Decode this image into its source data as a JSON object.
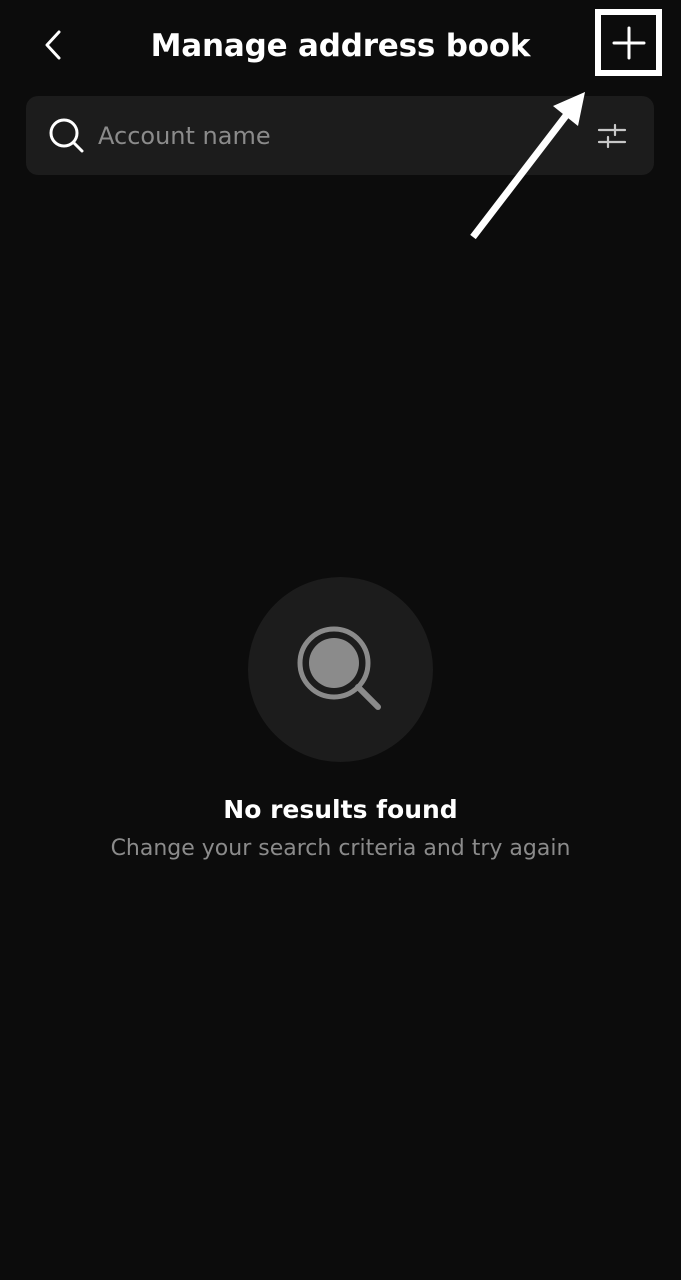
{
  "header": {
    "title": "Manage address book",
    "back_icon": "chevron-left-icon",
    "add_icon": "plus-icon"
  },
  "search": {
    "placeholder": "Account name",
    "search_icon": "search-icon",
    "filter_icon": "sliders-icon"
  },
  "empty_state": {
    "icon": "magnifier-icon",
    "title": "No results found",
    "subtitle": "Change your search criteria and try again"
  },
  "colors": {
    "background": "#0c0c0c",
    "surface": "#1c1c1c",
    "text_primary": "#ffffff",
    "text_secondary": "#8b8b8b"
  }
}
